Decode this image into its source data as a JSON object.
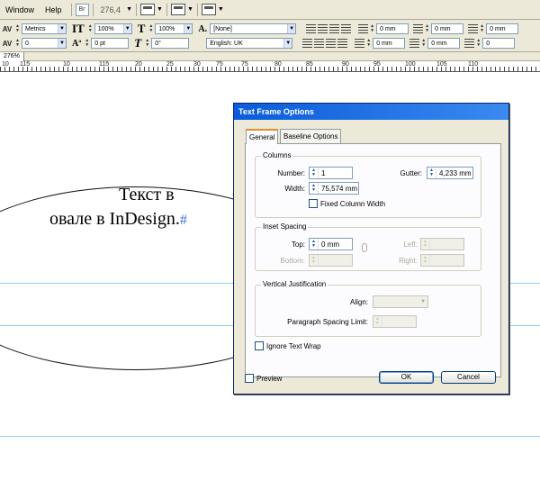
{
  "menu": {
    "window": "Window",
    "help": "Help",
    "bridge": "Br",
    "zoom": "276,4"
  },
  "control_bar": {
    "kerning": "Metrics",
    "tracking": "0",
    "vertical_scale": "100%",
    "baseline_shift": "0 pt",
    "horizontal_scale": "100%",
    "skew": "0°",
    "char_style": "[None]",
    "language": "English: UK",
    "indents": [
      "0 mm",
      "0 mm",
      "0 mm",
      "0 mm",
      "0 mm",
      "0"
    ]
  },
  "document_tab": "276%",
  "ruler_labels": [
    "10",
    "115",
    "10",
    "115",
    "20",
    "25",
    "30",
    "75",
    "75",
    "80",
    "85",
    "90",
    "95",
    "100",
    "105",
    "110"
  ],
  "canvas": {
    "line1": "Текст в",
    "line2": "овале в InDesign.",
    "hash": "#"
  },
  "dialog": {
    "title": "Text Frame Options",
    "tabs": [
      "General",
      "Baseline Options"
    ],
    "columns": {
      "title": "Columns",
      "number_label": "Number:",
      "number_value": "1",
      "gutter_label": "Gutter:",
      "gutter_value": "4,233 mm",
      "width_label": "Width:",
      "width_value": "75,574 mm",
      "fixed_label": "Fixed Column Width"
    },
    "inset": {
      "title": "Inset Spacing",
      "top_label": "Top:",
      "top_value": "0 mm",
      "bottom_label": "Bottom:",
      "left_label": "Left:",
      "right_label": "Right:"
    },
    "vertical": {
      "title": "Vertical Justification",
      "align_label": "Align:",
      "para_label": "Paragraph Spacing Limit:"
    },
    "ignore_wrap": "Ignore Text Wrap",
    "preview": "Preview",
    "ok": "OK",
    "cancel": "Cancel"
  }
}
